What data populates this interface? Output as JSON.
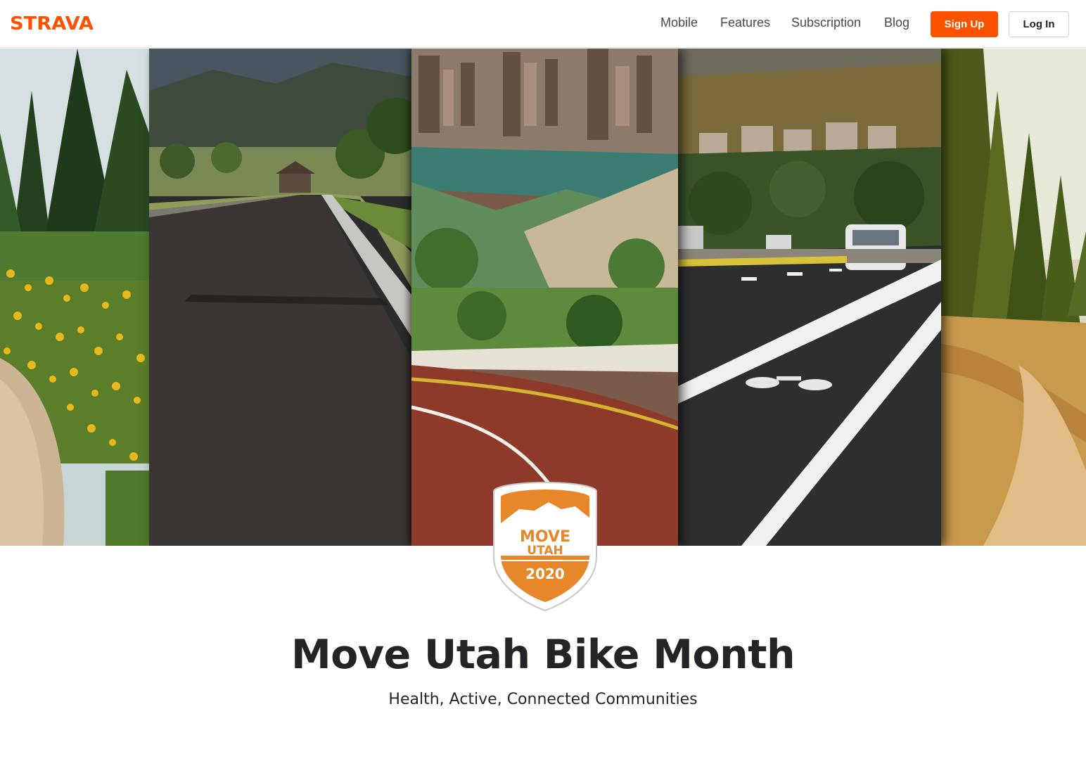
{
  "header": {
    "logo": "STRAVA",
    "nav": [
      {
        "label": "Mobile"
      },
      {
        "label": "Features"
      },
      {
        "label": "Subscription"
      },
      {
        "label": "Blog"
      }
    ],
    "signup_label": "Sign Up",
    "login_label": "Log In"
  },
  "badge": {
    "line1": "MOVE",
    "line2": "UTAH",
    "year": "2020",
    "accent_color": "#e8862a"
  },
  "hero_panels": [
    {
      "icon": "wildflower-trail-photo"
    },
    {
      "icon": "suburban-road-photo"
    },
    {
      "icon": "canyon-road-photo"
    },
    {
      "icon": "bike-lane-photo"
    },
    {
      "icon": "forest-dirt-trail-photo"
    }
  ],
  "main": {
    "title": "Move Utah Bike Month",
    "subtitle": "Health, Active, Connected Communities"
  },
  "colors": {
    "brand": "#fc5200",
    "text": "#242428"
  }
}
